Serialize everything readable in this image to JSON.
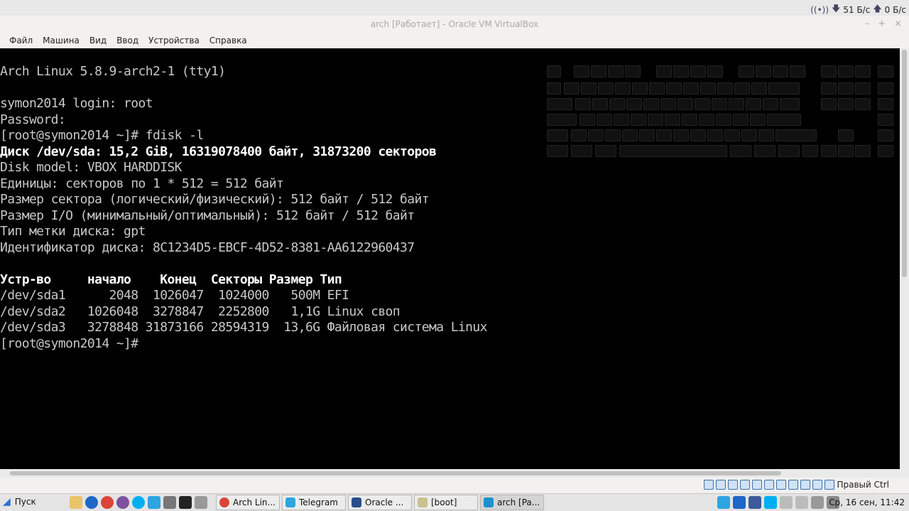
{
  "topbar": {
    "net_down": "51 Б/с",
    "net_up": "0 Б/с"
  },
  "window": {
    "title": "arch [Работает] - Oracle VM VirtualBox"
  },
  "menu": [
    "Файл",
    "Машина",
    "Вид",
    "Ввод",
    "Устройства",
    "Справка"
  ],
  "terminal": {
    "lines": [
      {
        "text": "Arch Linux 5.8.9-arch2-1 (tty1)",
        "bold": false
      },
      {
        "text": "",
        "bold": false
      },
      {
        "text": "symon2014 login: root",
        "bold": false
      },
      {
        "text": "Password:",
        "bold": false
      },
      {
        "text": "[root@symon2014 ~]# fdisk -l",
        "bold": false
      },
      {
        "text": "Диск /dev/sda: 15,2 GiB, 16319078400 байт, 31873200 секторов",
        "bold": true
      },
      {
        "text": "Disk model: VBOX HARDDISK",
        "bold": false
      },
      {
        "text": "Единицы: секторов по 1 * 512 = 512 байт",
        "bold": false
      },
      {
        "text": "Размер сектора (логический/физический): 512 байт / 512 байт",
        "bold": false
      },
      {
        "text": "Размер I/O (минимальный/оптимальный): 512 байт / 512 байт",
        "bold": false
      },
      {
        "text": "Тип метки диска: gpt",
        "bold": false
      },
      {
        "text": "Идентификатор диска: 8C1234D5-EBCF-4D52-8381-AA6122960437",
        "bold": false
      },
      {
        "text": "",
        "bold": false
      },
      {
        "text": "Устр-во     начало    Конец  Секторы Размер Тип",
        "bold": true
      },
      {
        "text": "/dev/sda1      2048  1026047  1024000   500M EFI",
        "bold": false
      },
      {
        "text": "/dev/sda2   1026048  3278847  2252800   1,1G Linux своп",
        "bold": false
      },
      {
        "text": "/dev/sda3   3278848 31873166 28594319  13,6G Файловая система Linux",
        "bold": false
      },
      {
        "text": "[root@symon2014 ~]#",
        "bold": false
      }
    ]
  },
  "vm_status": {
    "host_key": "Правый Ctrl"
  },
  "taskbar": {
    "start": "Пуск",
    "tasks": [
      "Arch Lin...",
      "Telegram",
      "Oracle ...",
      "[boot]",
      "arch [Pa..."
    ],
    "clock": "Ср, 16 сен, 11:42"
  }
}
